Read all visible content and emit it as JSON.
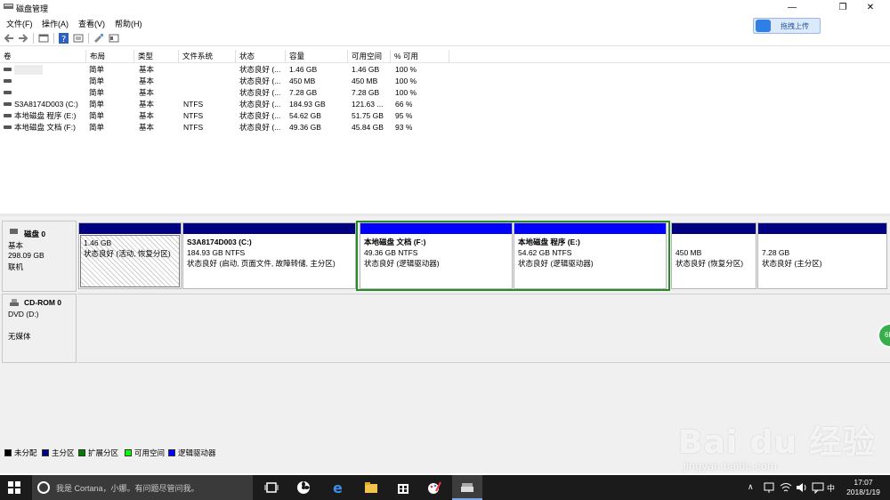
{
  "window": {
    "title": "磁盘管理"
  },
  "menu": [
    "文件(F)",
    "操作(A)",
    "查看(V)",
    "帮助(H)"
  ],
  "baidu_upload": {
    "label": "拖拽上传",
    "icon": "baidu-cloud-icon"
  },
  "volume_table": {
    "columns": [
      "卷",
      "布局",
      "类型",
      "文件系统",
      "状态",
      "容量",
      "可用空间",
      "% 可用"
    ],
    "rows": [
      [
        "",
        "简单",
        "基本",
        "",
        "状态良好 (...",
        "1.46 GB",
        "1.46 GB",
        "100 %"
      ],
      [
        "",
        "简单",
        "基本",
        "",
        "状态良好 (...",
        "450 MB",
        "450 MB",
        "100 %"
      ],
      [
        "",
        "简单",
        "基本",
        "",
        "状态良好 (...",
        "7.28 GB",
        "7.28 GB",
        "100 %"
      ],
      [
        "S3A8174D003 (C:)",
        "简单",
        "基本",
        "NTFS",
        "状态良好 (...",
        "184.93 GB",
        "121.63 ...",
        "66 %"
      ],
      [
        "本地磁盘 程序 (E:)",
        "简单",
        "基本",
        "NTFS",
        "状态良好 (...",
        "54.62 GB",
        "51.75 GB",
        "95 %"
      ],
      [
        "本地磁盘 文档 (F:)",
        "简单",
        "基本",
        "NTFS",
        "状态良好 (...",
        "49.36 GB",
        "45.84 GB",
        "93 %"
      ]
    ]
  },
  "disk0": {
    "name": "磁盘 0",
    "type": "基本",
    "size": "298.09 GB",
    "status": "联机",
    "partitions": [
      {
        "name": "",
        "size": "1.46 GB",
        "status": "状态良好 (活动, 恢复分区)"
      },
      {
        "name": "S3A8174D003 (C:)",
        "size": "184.93 GB NTFS",
        "status": "状态良好 (启动, 页面文件, 故障转储, 主分区)"
      },
      {
        "name": "本地磁盘 文档 (F:)",
        "size": "49.36 GB NTFS",
        "status": "状态良好 (逻辑驱动器)"
      },
      {
        "name": "本地磁盘 程序 (E:)",
        "size": "54.62 GB NTFS",
        "status": "状态良好 (逻辑驱动器)"
      },
      {
        "name": "",
        "size": "450 MB",
        "status": "状态良好 (恢复分区)"
      },
      {
        "name": "",
        "size": "7.28 GB",
        "status": "状态良好 (主分区)"
      }
    ]
  },
  "cdrom0": {
    "name": "CD-ROM 0",
    "drive": "DVD (D:)",
    "media": "无媒体"
  },
  "legend": [
    {
      "label": "未分配",
      "color": "#000000"
    },
    {
      "label": "主分区",
      "color": "#000080"
    },
    {
      "label": "扩展分区",
      "color": "#008000"
    },
    {
      "label": "可用空间",
      "color": "#00ff00"
    },
    {
      "label": "逻辑驱动器",
      "color": "#0000ff"
    }
  ],
  "colors": {
    "primary_bar": "#000080",
    "logical_bar": "#0000ff",
    "extended_frame": "#2a8a2a"
  },
  "bubble_text": "6B",
  "taskbar": {
    "search_placeholder": "我是 Cortana，小娜。有问题尽管问我。",
    "ime": "中",
    "time": "17:07",
    "date": "2018/1/19"
  },
  "watermark": {
    "brand": "Bai du 经验",
    "url": "jingyan.baidu.com"
  }
}
